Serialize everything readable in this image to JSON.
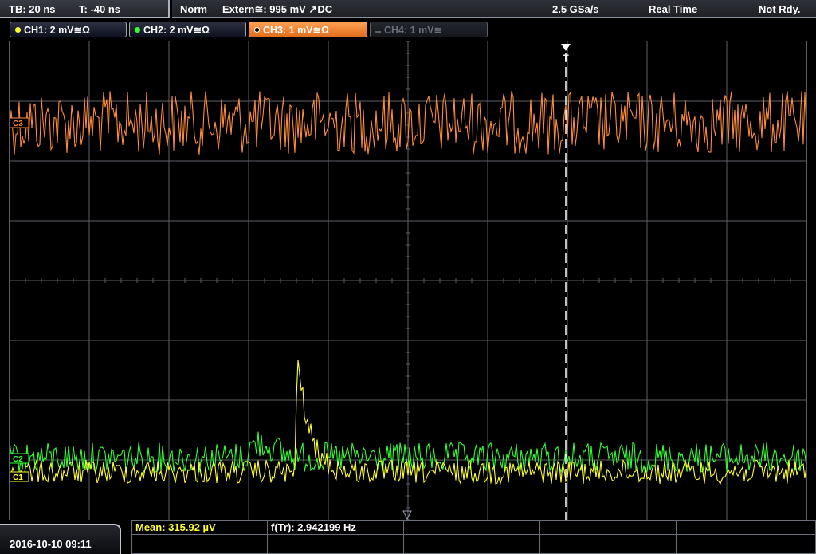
{
  "topbar": {
    "timebase": "TB: 20 ns",
    "trigger_offset": "T: -40 ns",
    "mode": "Norm",
    "trigger": "Extern≅: 995 mV ↗DC",
    "sample_rate": "2.5 GSa/s",
    "acq_mode": "Real Time",
    "status": "Not Rdy."
  },
  "channels": [
    {
      "label": "CH1: 2 mV≅Ω",
      "color": "#ffff33",
      "active": true
    },
    {
      "label": "CH2: 2 mV≅Ω",
      "color": "#33ff33",
      "active": true
    },
    {
      "label": "CH3: 1 mV≅Ω",
      "color": "#ff8c3a",
      "active": true
    },
    {
      "label": "CH4: 1 mV≅",
      "color": "#6a6f78",
      "active": false
    }
  ],
  "waveform_markers": {
    "ch3": "C3",
    "ch2": "C2",
    "ch1": "C1",
    "trigger": "T"
  },
  "measurements": {
    "mean": "Mean: 315.92 µV",
    "frequency": "f(Tr): 2.942199 Hz"
  },
  "datetime": "2016-10-10 09:11",
  "colors": {
    "ch1": "#ffff33",
    "ch2": "#33ff33",
    "ch3": "#ff8c3a",
    "grid": "#5b5f66"
  }
}
